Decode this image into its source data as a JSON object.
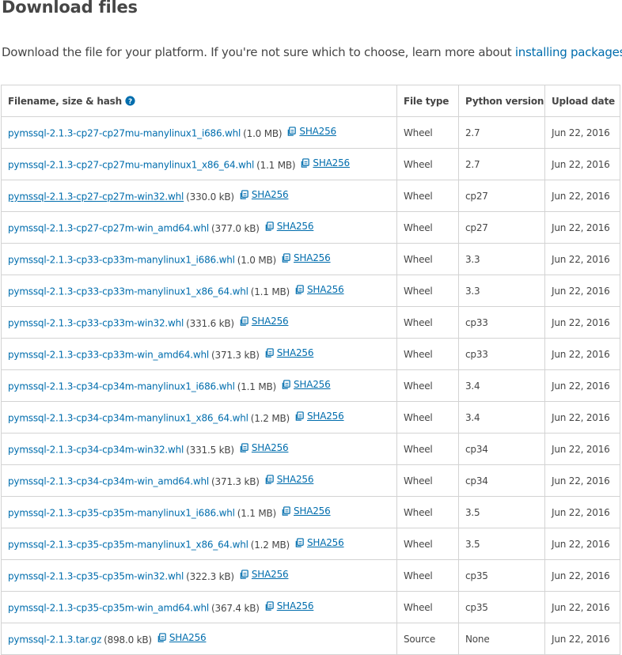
{
  "page": {
    "title": "Download files",
    "intro_text": "Download the file for your platform. If you're not sure which to choose, learn more about ",
    "intro_link": "installing packages",
    "intro_end": "."
  },
  "table": {
    "headers": {
      "filename": "Filename, size & hash",
      "file_type": "File type",
      "python_version": "Python version",
      "upload_date": "Upload date"
    },
    "rows": [
      {
        "filename": "pymssql-2.1.3-cp27-cp27mu-manylinux1_i686.whl",
        "size": "(1.0 MB)",
        "hash": "SHA256",
        "type": "Wheel",
        "python": "2.7",
        "date": "Jun 22, 2016"
      },
      {
        "filename": "pymssql-2.1.3-cp27-cp27mu-manylinux1_x86_64.whl",
        "size": "(1.1 MB)",
        "hash": "SHA256",
        "type": "Wheel",
        "python": "2.7",
        "date": "Jun 22, 2016"
      },
      {
        "filename": "pymssql-2.1.3-cp27-cp27m-win32.whl",
        "size": "(330.0 kB)",
        "hash": "SHA256",
        "type": "Wheel",
        "python": "cp27",
        "date": "Jun 22, 2016"
      },
      {
        "filename": "pymssql-2.1.3-cp27-cp27m-win_amd64.whl",
        "size": "(377.0 kB)",
        "hash": "SHA256",
        "type": "Wheel",
        "python": "cp27",
        "date": "Jun 22, 2016"
      },
      {
        "filename": "pymssql-2.1.3-cp33-cp33m-manylinux1_i686.whl",
        "size": "(1.0 MB)",
        "hash": "SHA256",
        "type": "Wheel",
        "python": "3.3",
        "date": "Jun 22, 2016"
      },
      {
        "filename": "pymssql-2.1.3-cp33-cp33m-manylinux1_x86_64.whl",
        "size": "(1.1 MB)",
        "hash": "SHA256",
        "type": "Wheel",
        "python": "3.3",
        "date": "Jun 22, 2016"
      },
      {
        "filename": "pymssql-2.1.3-cp33-cp33m-win32.whl",
        "size": "(331.6 kB)",
        "hash": "SHA256",
        "type": "Wheel",
        "python": "cp33",
        "date": "Jun 22, 2016"
      },
      {
        "filename": "pymssql-2.1.3-cp33-cp33m-win_amd64.whl",
        "size": "(371.3 kB)",
        "hash": "SHA256",
        "type": "Wheel",
        "python": "cp33",
        "date": "Jun 22, 2016"
      },
      {
        "filename": "pymssql-2.1.3-cp34-cp34m-manylinux1_i686.whl",
        "size": "(1.1 MB)",
        "hash": "SHA256",
        "type": "Wheel",
        "python": "3.4",
        "date": "Jun 22, 2016"
      },
      {
        "filename": "pymssql-2.1.3-cp34-cp34m-manylinux1_x86_64.whl",
        "size": "(1.2 MB)",
        "hash": "SHA256",
        "type": "Wheel",
        "python": "3.4",
        "date": "Jun 22, 2016"
      },
      {
        "filename": "pymssql-2.1.3-cp34-cp34m-win32.whl",
        "size": "(331.5 kB)",
        "hash": "SHA256",
        "type": "Wheel",
        "python": "cp34",
        "date": "Jun 22, 2016"
      },
      {
        "filename": "pymssql-2.1.3-cp34-cp34m-win_amd64.whl",
        "size": "(371.3 kB)",
        "hash": "SHA256",
        "type": "Wheel",
        "python": "cp34",
        "date": "Jun 22, 2016"
      },
      {
        "filename": "pymssql-2.1.3-cp35-cp35m-manylinux1_i686.whl",
        "size": "(1.1 MB)",
        "hash": "SHA256",
        "type": "Wheel",
        "python": "3.5",
        "date": "Jun 22, 2016"
      },
      {
        "filename": "pymssql-2.1.3-cp35-cp35m-manylinux1_x86_64.whl",
        "size": "(1.2 MB)",
        "hash": "SHA256",
        "type": "Wheel",
        "python": "3.5",
        "date": "Jun 22, 2016"
      },
      {
        "filename": "pymssql-2.1.3-cp35-cp35m-win32.whl",
        "size": "(322.3 kB)",
        "hash": "SHA256",
        "type": "Wheel",
        "python": "cp35",
        "date": "Jun 22, 2016"
      },
      {
        "filename": "pymssql-2.1.3-cp35-cp35m-win_amd64.whl",
        "size": "(367.4 kB)",
        "hash": "SHA256",
        "type": "Wheel",
        "python": "cp35",
        "date": "Jun 22, 2016"
      },
      {
        "filename": "pymssql-2.1.3.tar.gz",
        "size": "(898.0 kB)",
        "hash": "SHA256",
        "type": "Source",
        "python": "None",
        "date": "Jun 22, 2016"
      }
    ]
  },
  "icons": {
    "help": "question-circle-icon",
    "copy": "copy-icon"
  },
  "colors": {
    "link": "#006dad",
    "text": "#464646",
    "border": "#d3d3d3"
  }
}
